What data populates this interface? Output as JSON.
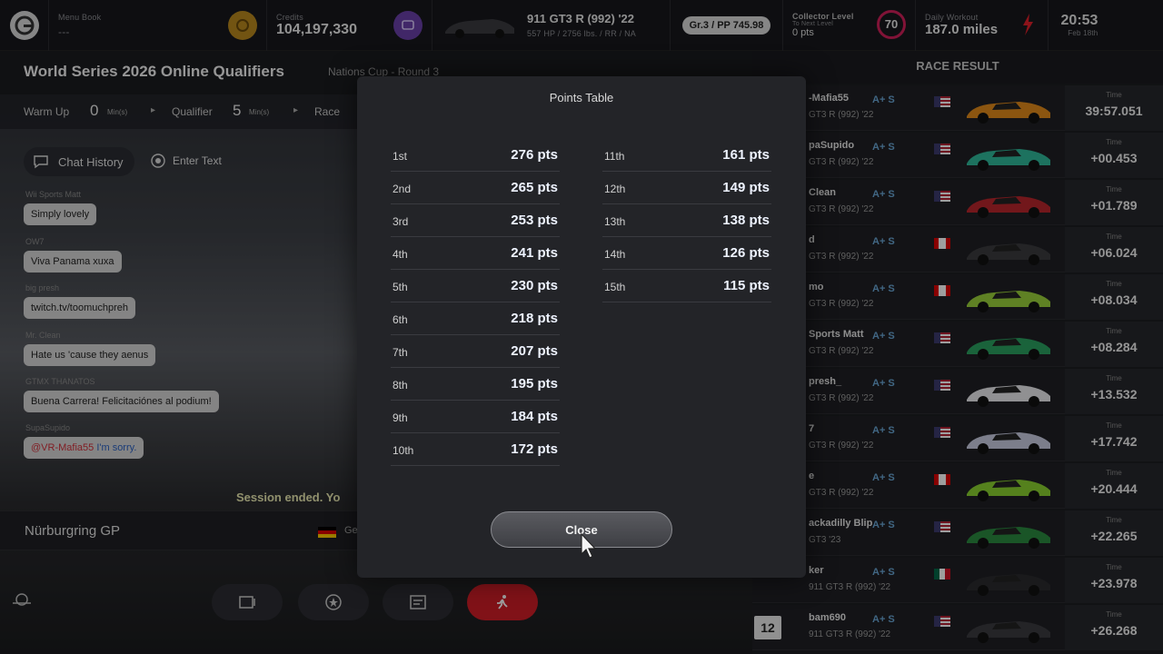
{
  "topbar": {
    "menu_book_label": "Menu Book",
    "menu_book_value": "---",
    "credits_label": "Credits",
    "credits_value": "104,197,330",
    "car_name": "911 GT3 R (992) '22",
    "car_specs": "557 HP / 2756 lbs. / RR / NA",
    "car_class": "Gr.3 / PP 745.98",
    "collector_label": "Collector Level",
    "collector_sub": "To Next Level",
    "collector_pts": "0 pts",
    "collector_level": "70",
    "workout_label": "Daily Workout",
    "workout_value": "187.0 miles",
    "clock_time": "20:53",
    "clock_date": "Feb 18th",
    "accent_red": "#e0202a"
  },
  "event": {
    "title": "World Series 2026 Online Qualifiers",
    "subtitle": "Nations Cup - Round 3",
    "warmup_label": "Warm Up",
    "warmup_value": "0",
    "warmup_unit": "Min(s)",
    "qualifier_label": "Qualifier",
    "qualifier_value": "5",
    "qualifier_unit": "Min(s)",
    "race_label": "Race"
  },
  "chat": {
    "history_label": "Chat History",
    "enter_text_label": "Enter Text",
    "messages": [
      {
        "name": "Wii Sports Matt",
        "text": "Simply lovely"
      },
      {
        "name": "OW7",
        "text": "Viva Panama xuxa"
      },
      {
        "name": "big presh",
        "text": "twitch.tv/toomuchpreh"
      },
      {
        "name": "Mr. Clean",
        "text": "Hate us 'cause they aenus"
      },
      {
        "name": "GTMX THANATOS",
        "text": "Buena Carrera! Felicitaciónes al podium!"
      },
      {
        "name": "SupaSupido",
        "mention": "@VR-Mafia55",
        "text": "I'm sorry."
      }
    ],
    "session_text": "Session ended. Yo"
  },
  "track": {
    "name": "Nürburgring GP",
    "country_short": "Ge"
  },
  "race_result": {
    "header": "RACE RESULT",
    "time_label": "Time",
    "rows": [
      {
        "name": "-Mafia55",
        "car": "GT3 R (992) '22",
        "rating": "A+ S",
        "flag": "us",
        "time": "39:57.051",
        "car_color": "#e08a1a"
      },
      {
        "name": "paSupido",
        "car": "GT3 R (992) '22",
        "rating": "A+ S",
        "flag": "us",
        "time": "+00.453",
        "car_color": "#2fb89a"
      },
      {
        "name": "Clean",
        "car": "GT3 R (992) '22",
        "rating": "A+ S",
        "flag": "us",
        "time": "+01.789",
        "car_color": "#b8262c"
      },
      {
        "name": "d",
        "car": "GT3 R (992) '22",
        "rating": "A+ S",
        "flag": "ca",
        "time": "+06.024",
        "car_color": "#3a3a3e"
      },
      {
        "name": "mo",
        "car": "GT3 R (992) '22",
        "rating": "A+ S",
        "flag": "ca",
        "time": "+08.034",
        "car_color": "#9ad03a"
      },
      {
        "name": "Sports Matt",
        "car": "GT3 R (992) '22",
        "rating": "A+ S",
        "flag": "us",
        "time": "+08.284",
        "car_color": "#2aa060"
      },
      {
        "name": "presh_",
        "car": "GT3 R (992) '22",
        "rating": "A+ S",
        "flag": "us",
        "time": "+13.532",
        "car_color": "#e8e8ec"
      },
      {
        "name": "7",
        "car": "GT3 R (992) '22",
        "rating": "A+ S",
        "flag": "us",
        "time": "+17.742",
        "car_color": "#c8cce0"
      },
      {
        "name": "e",
        "car": "GT3 R (992) '22",
        "rating": "A+ S",
        "flag": "ca",
        "time": "+20.444",
        "car_color": "#8ad030"
      },
      {
        "name": "ackadilly Blip",
        "car": "GT3 '23",
        "rating": "A+ S",
        "flag": "us",
        "time": "+22.265",
        "car_color": "#2a8a40"
      },
      {
        "name": "ker",
        "car": "911 GT3 R (992) '22",
        "rating": "A+ S",
        "flag": "mx",
        "time": "+23.978",
        "car_color": "#2a2a2e"
      },
      {
        "name": "bam690",
        "pos": "12",
        "car": "911 GT3 R (992) '22",
        "rating": "A+ S",
        "flag": "us",
        "time": "+26.268",
        "car_color": "#3a3a40"
      }
    ]
  },
  "modal": {
    "title": "Points Table",
    "left": [
      {
        "pos": "1st",
        "pts": "276 pts"
      },
      {
        "pos": "2nd",
        "pts": "265 pts"
      },
      {
        "pos": "3rd",
        "pts": "253 pts"
      },
      {
        "pos": "4th",
        "pts": "241 pts"
      },
      {
        "pos": "5th",
        "pts": "230 pts"
      },
      {
        "pos": "6th",
        "pts": "218 pts"
      },
      {
        "pos": "7th",
        "pts": "207 pts"
      },
      {
        "pos": "8th",
        "pts": "195 pts"
      },
      {
        "pos": "9th",
        "pts": "184 pts"
      },
      {
        "pos": "10th",
        "pts": "172 pts"
      }
    ],
    "right": [
      {
        "pos": "11th",
        "pts": "161 pts"
      },
      {
        "pos": "12th",
        "pts": "149 pts"
      },
      {
        "pos": "13th",
        "pts": "138 pts"
      },
      {
        "pos": "14th",
        "pts": "126 pts"
      },
      {
        "pos": "15th",
        "pts": "115 pts"
      }
    ],
    "close_label": "Close"
  }
}
